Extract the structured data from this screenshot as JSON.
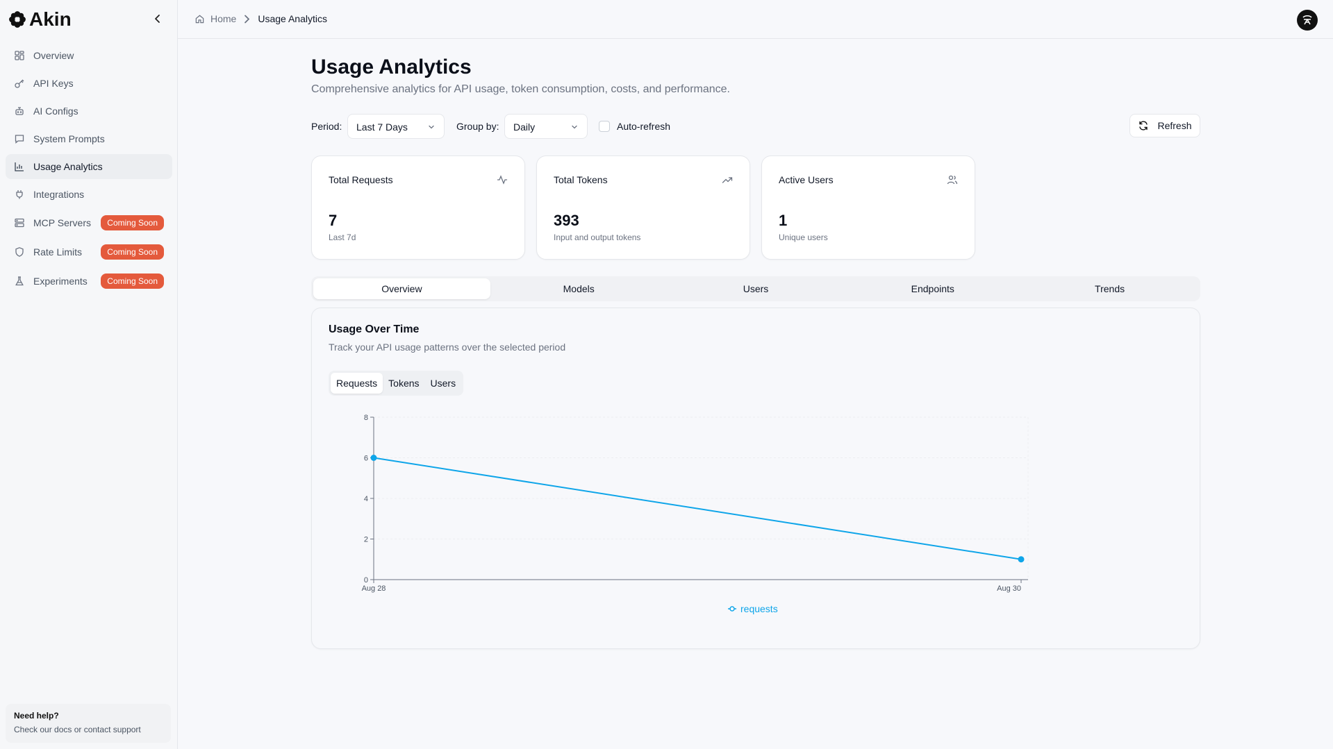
{
  "brand": {
    "name": "Akin"
  },
  "sidebar": {
    "items": [
      {
        "label": "Overview",
        "icon": "grid-icon"
      },
      {
        "label": "API Keys",
        "icon": "key-icon"
      },
      {
        "label": "AI Configs",
        "icon": "bot-icon"
      },
      {
        "label": "System Prompts",
        "icon": "message-icon"
      },
      {
        "label": "Usage Analytics",
        "icon": "bar-chart-icon",
        "active": true
      },
      {
        "label": "Integrations",
        "icon": "plug-icon"
      },
      {
        "label": "MCP Servers",
        "icon": "server-icon",
        "badge": "Coming Soon"
      },
      {
        "label": "Rate Limits",
        "icon": "shield-icon",
        "badge": "Coming Soon"
      },
      {
        "label": "Experiments",
        "icon": "flask-icon",
        "badge": "Coming Soon"
      }
    ],
    "help": {
      "title": "Need help?",
      "text": "Check our docs or contact support"
    }
  },
  "breadcrumb": {
    "home": "Home",
    "current": "Usage Analytics"
  },
  "page": {
    "title": "Usage Analytics",
    "subtitle": "Comprehensive analytics for API usage, token consumption, costs, and performance."
  },
  "controls": {
    "period_label": "Period:",
    "period_value": "Last 7 Days",
    "group_label": "Group by:",
    "group_value": "Daily",
    "auto_refresh": "Auto-refresh",
    "refresh": "Refresh"
  },
  "stats": [
    {
      "label": "Total Requests",
      "value": "7",
      "sub": "Last 7d",
      "icon": "activity-icon"
    },
    {
      "label": "Total Tokens",
      "value": "393",
      "sub": "Input and output tokens",
      "icon": "trending-up-icon"
    },
    {
      "label": "Active Users",
      "value": "1",
      "sub": "Unique users",
      "icon": "users-icon"
    }
  ],
  "tabs": [
    "Overview",
    "Models",
    "Users",
    "Endpoints",
    "Trends"
  ],
  "panel": {
    "title": "Usage Over Time",
    "subtitle": "Track your API usage patterns over the selected period",
    "subtabs": [
      "Requests",
      "Tokens",
      "Users"
    ]
  },
  "colors": {
    "accent": "#0ea5e9",
    "badge": "#e45a3c"
  },
  "chart_data": {
    "type": "line",
    "x": [
      "Aug 28",
      "Aug 30"
    ],
    "series": [
      {
        "name": "requests",
        "values": [
          6,
          1
        ]
      }
    ],
    "yticks": [
      0,
      2,
      4,
      6,
      8
    ],
    "ylim": [
      0,
      8
    ],
    "grid": true,
    "legend": "bottom-center"
  }
}
